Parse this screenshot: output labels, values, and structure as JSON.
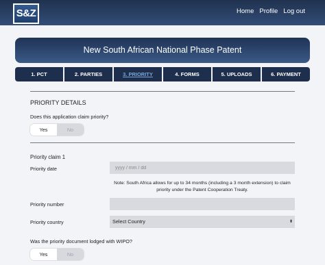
{
  "header": {
    "logo_text": "S&Z",
    "nav": [
      "Home",
      "Profile",
      "Log out"
    ]
  },
  "banner": {
    "title": "New South African National Phase Patent"
  },
  "steps": [
    {
      "label": "1. PCT",
      "active": false
    },
    {
      "label": "2. PARTIES",
      "active": false
    },
    {
      "label": "3. PRIORITY",
      "active": true
    },
    {
      "label": "4. FORMS",
      "active": false
    },
    {
      "label": "5. UPLOADS",
      "active": false
    },
    {
      "label": "6. PAYMENT",
      "active": false
    }
  ],
  "form": {
    "section_title": "PRIORITY DETAILS",
    "claim_question": "Does this application claim priority?",
    "claim_toggle": {
      "yes": "Yes",
      "no": "No",
      "selected": "Yes"
    },
    "claim_heading": "Priority claim 1",
    "priority_date": {
      "label": "Priority date",
      "placeholder": "yyyy / mm / dd",
      "value": ""
    },
    "note": "Note: South Africa allows for up to 34 months (including a 3 month extension) to claim priority under the Patent Cooperation Treaty.",
    "priority_number": {
      "label": "Priority number",
      "value": ""
    },
    "priority_country": {
      "label": "Priority country",
      "value": "Select Country"
    },
    "wipo_question": "Was the priority document lodged with WIPO?",
    "wipo_toggle": {
      "yes": "Yes",
      "no": "No",
      "selected": "Yes"
    }
  },
  "colors": {
    "topbar": "#2a4064",
    "tab_background": "#1e2f4e",
    "active_tab_text": "#7aa6d8",
    "page_background": "#f3f4f8",
    "input_background": "#d8dadf"
  }
}
